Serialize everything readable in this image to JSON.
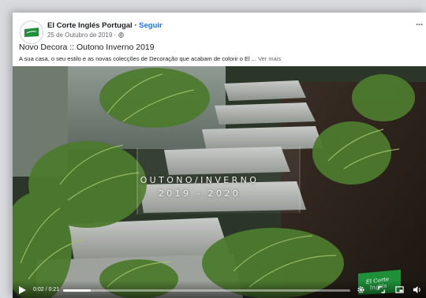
{
  "post": {
    "page_name": "El Corte Inglés Portugal",
    "separator": " · ",
    "follow_label": "Seguir",
    "date": "25 de Outubro de 2019 · ",
    "more_label": "···",
    "title": "Novo Decora :: Outono Inverno 2019",
    "text": "A sua casa, o seu estilo e as novas colecções de Decoração que acabam de colorir o El ... ",
    "see_more": "Ver mais"
  },
  "video": {
    "overlay_line1": "OUTONO/INVERNO",
    "overlay_line2": "2019 - 2020",
    "brand_watermark": "El Corte Inglés",
    "current_time": "0:02",
    "time_separator": " / ",
    "duration": "0:21",
    "progress": 0.095
  },
  "icons": {
    "logo": "el-corte-ingles-logo",
    "globe": "globe-icon",
    "play": "play-icon",
    "settings": "gear-icon",
    "expand": "expand-icon",
    "pip": "picture-in-picture-icon",
    "volume": "volume-icon"
  },
  "colors": {
    "brand_green": "#1f8f3a",
    "link_blue": "#1877f2"
  }
}
